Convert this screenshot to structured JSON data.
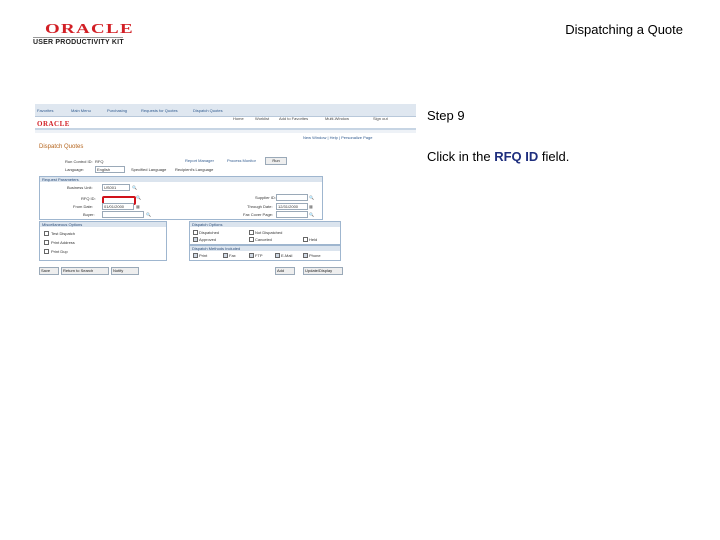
{
  "header": {
    "logo_brand": "ORACLE",
    "logo_subtitle": "USER PRODUCTIVITY KIT",
    "title": "Dispatching a Quote"
  },
  "step": {
    "label": "Step 9"
  },
  "instruction": {
    "prefix": "Click in the ",
    "field": "RFQ ID",
    "suffix": " field."
  },
  "screenshot": {
    "breadcrumb": [
      "Favorites",
      "Main Menu",
      "Purchasing",
      "Requests for Quotes",
      "Dispatch Quotes"
    ],
    "brand": "ORACLE",
    "top_links": [
      "Home",
      "Worklist",
      "Add to Favorites",
      "Multi-Window",
      "Sign out"
    ],
    "personalize": "New Window | Help | Personalize Page",
    "page_title": "Dispatch Quotes",
    "run_control_label": "Run Control ID:",
    "run_control_value": "RFQ",
    "report_manager": "Report Manager",
    "process_monitor": "Process Monitor",
    "run_button": "Run",
    "language_label": "Language:",
    "language_value": "English",
    "specified_language": "Specified Language",
    "recipients_language": "Recipient's Language",
    "request_group_title": "Request Parameters",
    "business_unit_label": "Business Unit:",
    "business_unit_value": "US001",
    "rfq_id_label": "RFQ ID:",
    "from_date_label": "From Date:",
    "from_date_value": "01/01/2000",
    "buyer_label": "Buyer:",
    "supplier_id_label": "Supplier ID:",
    "through_date_label": "Through Date:",
    "through_date_value": "12/31/2000",
    "fax_cover_label": "Fax Cover Page:",
    "misc_group_title": "Miscellaneous Options",
    "misc_options": [
      "Test Dispatch",
      "Print Address",
      "Print Dup"
    ],
    "dispatch_group_title": "Dispatch Options",
    "dispatch_options": [
      "Dispatched",
      "Not Dispatched",
      "Approved",
      "Canceled",
      "Held"
    ],
    "dispatch_method_title": "Dispatch Methods Included",
    "dispatch_methods": [
      "Print",
      "Fax",
      "FTP",
      "E-Mail",
      "Phone"
    ],
    "bottom_buttons": [
      "Save",
      "Return to Search",
      "Notify"
    ],
    "add_button": "Add",
    "update_button": "Update/Display"
  }
}
